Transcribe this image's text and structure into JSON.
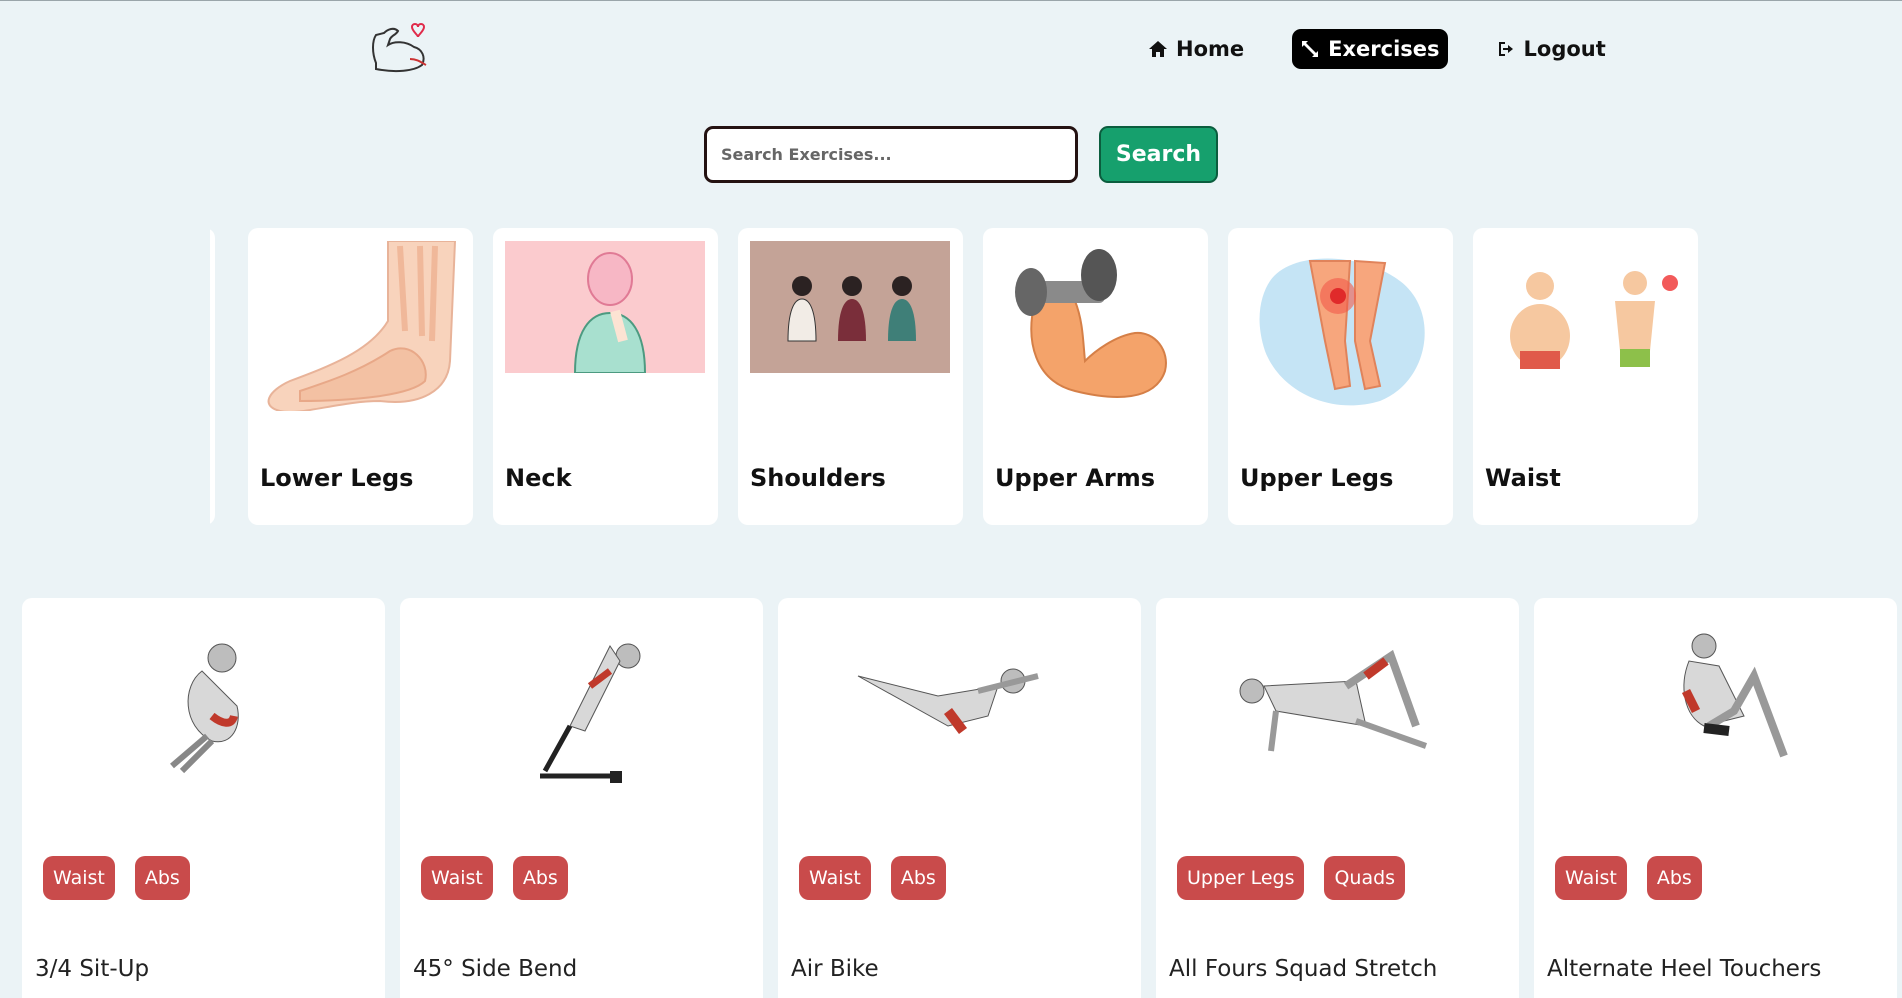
{
  "nav": {
    "home": "Home",
    "exercises": "Exercises",
    "logout": "Logout"
  },
  "search": {
    "placeholder": "Search Exercises...",
    "button": "Search"
  },
  "body_parts": [
    {
      "label": "Lower Legs"
    },
    {
      "label": "Neck"
    },
    {
      "label": "Shoulders"
    },
    {
      "label": "Upper Arms"
    },
    {
      "label": "Upper Legs"
    },
    {
      "label": "Waist"
    }
  ],
  "exercises": [
    {
      "name": "3/4 Sit-Up",
      "tags": [
        "Waist",
        "Abs"
      ]
    },
    {
      "name": "45° Side Bend",
      "tags": [
        "Waist",
        "Abs"
      ]
    },
    {
      "name": "Air Bike",
      "tags": [
        "Waist",
        "Abs"
      ]
    },
    {
      "name": "All Fours Squad Stretch",
      "tags": [
        "Upper Legs",
        "Quads"
      ]
    },
    {
      "name": "Alternate Heel Touchers",
      "tags": [
        "Waist",
        "Abs"
      ]
    }
  ],
  "colors": {
    "background": "#ebf3f6",
    "accent_green": "#16a06d",
    "tag_red": "#c94b4b",
    "nav_active": "#000000"
  },
  "icons": {
    "logo": "flexed-arm-heart-icon",
    "home": "house-icon",
    "exercises": "arrows-expand-icon",
    "logout": "sign-out-icon"
  }
}
